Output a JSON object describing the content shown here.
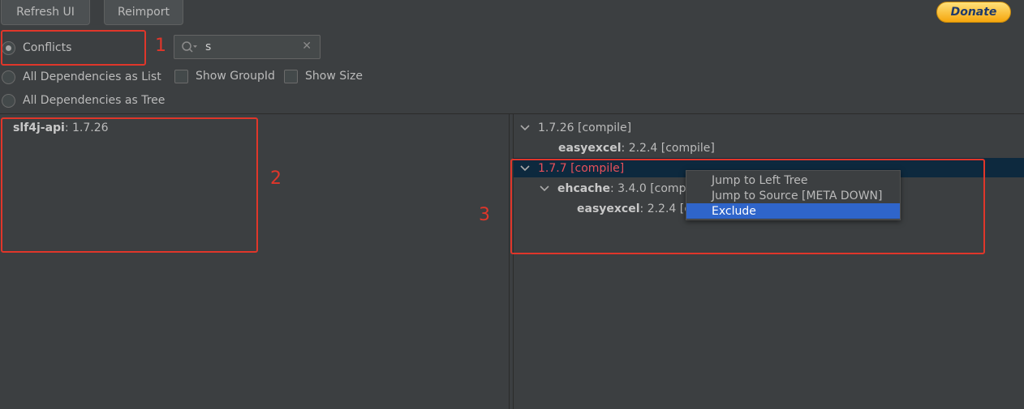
{
  "toolbar": {
    "refresh_label": "Refresh UI",
    "reimport_label": "Reimport",
    "donate_label": "Donate"
  },
  "filters": {
    "conflicts_label": "Conflicts",
    "list_label": "All Dependencies as List",
    "tree_label": "All Dependencies as Tree",
    "show_groupid_label": "Show GroupId",
    "show_size_label": "Show Size",
    "selected": "Conflicts"
  },
  "search": {
    "value": "s",
    "clear_glyph": "✕"
  },
  "annotations": {
    "n1": "1",
    "n2": "2",
    "n3": "3",
    "color": "#e0362a"
  },
  "left_tree": {
    "items": [
      {
        "name": "slf4j-api",
        "version": " : 1.7.26"
      }
    ]
  },
  "right_tree": {
    "rows": [
      {
        "text": "1.7.26 [compile]"
      },
      {
        "name": "easyexcel",
        "detail": " : 2.2.4 [compile]"
      },
      {
        "text": "1.7.7 [compile]"
      },
      {
        "name": "ehcache",
        "detail": " : 3.4.0 [comp"
      },
      {
        "name": "easyexcel",
        "detail": " : 2.2.4 [c"
      }
    ]
  },
  "context_menu": {
    "items": [
      {
        "label": "Jump to Left Tree"
      },
      {
        "label": "Jump to Source [META DOWN]"
      },
      {
        "label": "Exclude"
      }
    ]
  },
  "colors": {
    "background": "#3c3f41",
    "selection": "#0d293e",
    "menu_highlight": "#2f65ca",
    "conflict_text": "#e8505b"
  }
}
